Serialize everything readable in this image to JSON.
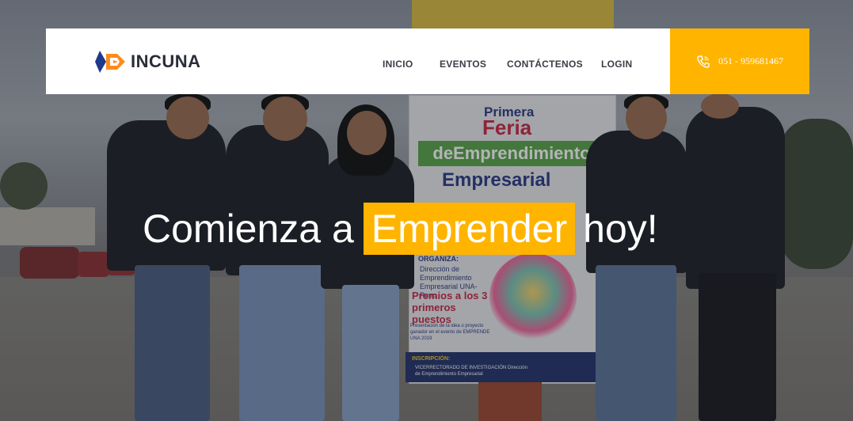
{
  "brand": {
    "name": "INCUNA",
    "accent_color": "#ffb400",
    "logo_colors": [
      "#1f3a8a",
      "#ff8c1a"
    ]
  },
  "nav": {
    "items": [
      {
        "label": "INICIO"
      },
      {
        "label": "EVENTOS"
      },
      {
        "label": "CONTÁCTENOS"
      },
      {
        "label": "LOGIN"
      }
    ],
    "phone": {
      "icon": "phone-icon",
      "number": "051 - 959681467"
    }
  },
  "hero": {
    "headline_before": "Comienza a",
    "headline_highlight": "Emprender",
    "headline_after": "hoy!"
  },
  "banner": {
    "line1": "Primera",
    "line2": "Feria",
    "line3": "deEmprendimiento",
    "line4": "Empresarial",
    "organiza": "ORGANIZA:",
    "organizer": "Dirección de Emprendimiento Empresarial UNA-Puno",
    "prize": "Premios a los 3 primeros puestos",
    "presentation": "Presentación de la idea o proyecto ganador en el evento de EMPRENDE UNA 2019",
    "inscripcion": "INSCRIPCIÓN:",
    "inscripcion_detail": "VICERRECTORADO DE INVESTIGACIÓN Dirección de Emprendimiento Empresarial"
  }
}
